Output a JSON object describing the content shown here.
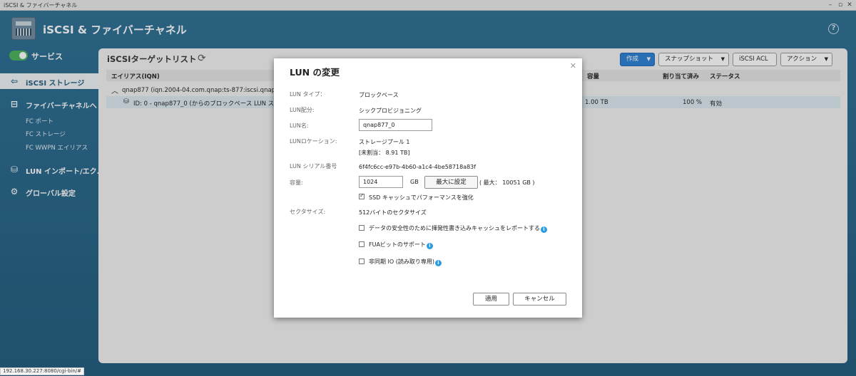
{
  "window": {
    "title": "iSCSI & ファイバーチャネル"
  },
  "app": {
    "title": "iSCSI & ファイバーチャネル",
    "help_icon": "help-icon"
  },
  "sidebar": {
    "service_label": "サービス",
    "service_enabled": true,
    "items": [
      {
        "label": "iSCSI ストレージ",
        "icon": "arrow-left-icon",
        "active": true
      },
      {
        "label": "ファイバーチャネルへ",
        "icon": "fibre-icon",
        "active": false
      },
      {
        "label": "LUN インポート/エク...",
        "icon": "database-icon",
        "active": false
      },
      {
        "label": "グローバル設定",
        "icon": "gear-icon",
        "active": false
      }
    ],
    "sub_items": [
      "FC ポート",
      "FC ストレージ",
      "FC WWPN エイリアス"
    ]
  },
  "main": {
    "title": "iSCSIターゲットリスト",
    "toolbar": {
      "create": "作成",
      "snapshot": "スナップショット",
      "acl": "iSCSI ACL",
      "action": "アクション"
    },
    "columns": {
      "alias": "エイリアス(IQN)",
      "capacity": "容量",
      "allocated": "割り当て済み",
      "status": "ステータス"
    },
    "rows": [
      {
        "text": "qnap877 (iqn.2004-04.com.qnap:ts-877:iscsi.qnap877.2a1"
      },
      {
        "text": "ID: 0 - qnap877_0 (からのブロックベース LUN ストレ",
        "capacity": "1.00 TB",
        "allocated": "100 %",
        "status": "有効"
      }
    ]
  },
  "modal": {
    "title": "LUN の変更",
    "lun_type_label": "LUN タイプ：",
    "lun_type": "ブロックベース",
    "lun_alloc_label": "LUN配分:",
    "lun_alloc": "シックプロビジョニング",
    "lun_name_label": "LUN名:",
    "lun_name": "qnap877_0",
    "lun_location_label": "LUNロケーション:",
    "lun_location": "ストレージプール 1",
    "unallocated": "[未割当： 8.91 TB]",
    "serial_label": "LUN シリアル番号",
    "serial": "6f4fc6cc-e97b-4b60-a1c4-4be58718a83f",
    "capacity_label": "容量:",
    "capacity": "1024",
    "capacity_unit": "GB",
    "max_button": "最大に設定",
    "max_text": "( 最大： 10051 GB )",
    "ssd_cache": "SSD キャッシュでパフォーマンスを強化",
    "ssd_cache_checked": true,
    "sector_label": "セクタサイズ:",
    "sector": "512バイトのセクタサイズ",
    "opt_report_cache": "データの安全性のために揮発性書き込みキャッシュをレポートする",
    "opt_fua": "FUAビットのサポート",
    "opt_async": "非同期 IO (読み取り専用)",
    "apply": "適用",
    "cancel": "キャンセル"
  },
  "statusbar": {
    "url": "192.168.30.227:8080/cgi-bin/#"
  }
}
